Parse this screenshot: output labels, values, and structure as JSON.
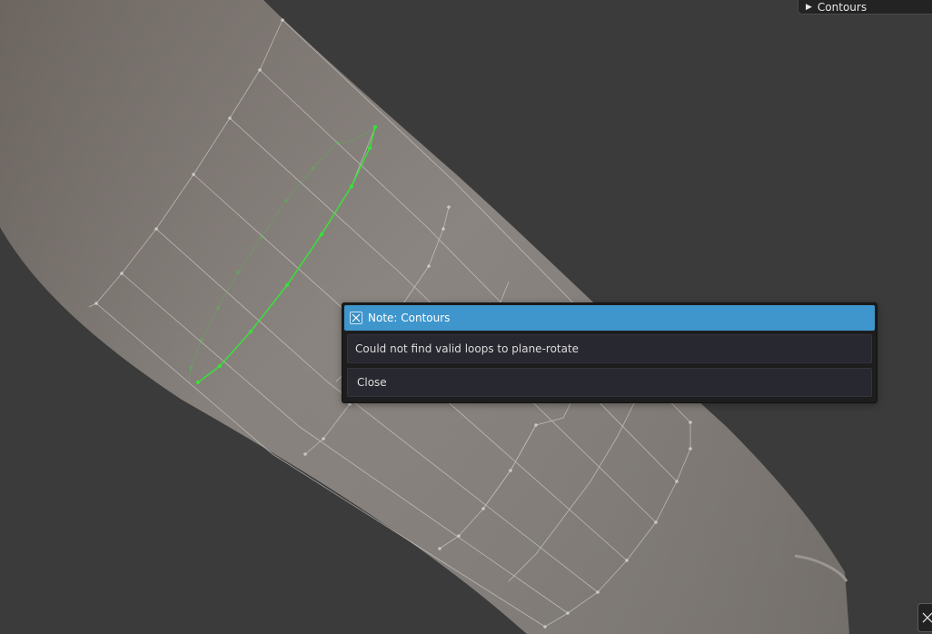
{
  "panel": {
    "triangle_icon": "▶",
    "label": "Contours"
  },
  "dialog": {
    "title": "Note: Contours",
    "message": "Could not find valid loops to plane-rotate",
    "close_label": "Close",
    "header_color": "#3f96cd"
  },
  "scene": {
    "background_color": "#3b3b3b",
    "mesh_color": "#6e6965",
    "wire_color": "#c8c8c8",
    "selected_loop_color": "#3ddc3d"
  },
  "icons": {
    "dialog_close": "close-icon",
    "corner_close": "close-icon",
    "panel_expand": "triangle-right-icon"
  }
}
